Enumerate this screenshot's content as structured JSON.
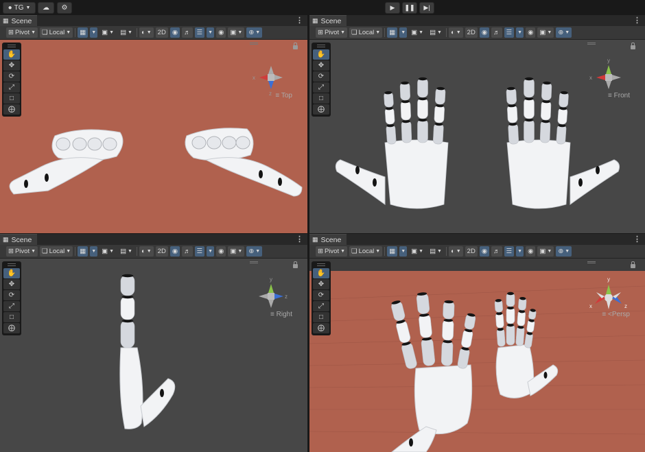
{
  "topbar": {
    "account_label": "TG",
    "play_controls": [
      "play",
      "pause",
      "step"
    ]
  },
  "panes": [
    {
      "id": "top-left",
      "tab": "Scene",
      "view_label": "Top",
      "gizmo_axes": [
        "x",
        "z"
      ]
    },
    {
      "id": "top-right",
      "tab": "Scene",
      "view_label": "Front",
      "gizmo_axes": [
        "y",
        "x"
      ]
    },
    {
      "id": "bottom-left",
      "tab": "Scene",
      "view_label": "Right",
      "gizmo_axes": [
        "y",
        "z"
      ]
    },
    {
      "id": "bottom-right",
      "tab": "Scene",
      "view_label": "<Persp",
      "gizmo_axes": [
        "y",
        "x",
        "z"
      ]
    }
  ],
  "toolbar": {
    "pivot_label": "Pivot",
    "local_label": "Local",
    "mode_2d_label": "2D"
  },
  "tools": [
    "hand-tool",
    "move-tool",
    "rotate-tool",
    "scale-tool",
    "rect-tool",
    "transform-tool"
  ],
  "colors": {
    "ground": "#b0614e",
    "background": "#282828",
    "toolbar": "#383838",
    "accent": "#46607c",
    "axis_x": "#d23a3a",
    "axis_y": "#8bc34a",
    "axis_z": "#3b6fd6"
  }
}
